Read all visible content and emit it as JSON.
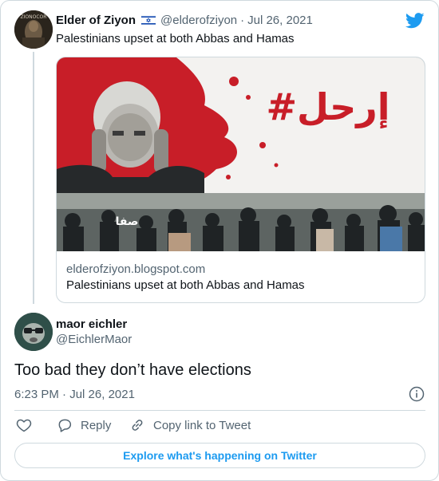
{
  "parent_tweet": {
    "author_name": "Elder of Ziyon",
    "flag_icon": "israel-flag-icon",
    "handle": "@elderofziyon",
    "separator": "·",
    "date": "Jul 26, 2021",
    "text": "Palestinians upset at both Abbas and Hamas",
    "avatar_label": "ZIONOCOR",
    "link_card": {
      "image_text_arabic": "#إرحل",
      "image_logo_text": "صفا",
      "domain": "elderofziyon.blogspot.com",
      "title": "Palestinians upset at both Abbas and Hamas"
    }
  },
  "reply_tweet": {
    "author_name": "maor eichler",
    "handle": "@EichlerMaor",
    "text": "Too bad they don’t have elections",
    "time": "6:23 PM",
    "separator": "·",
    "date": "Jul 26, 2021"
  },
  "actions": {
    "like_icon": "heart-icon",
    "reply_label": "Reply",
    "copy_label": "Copy link to Tweet"
  },
  "footer": {
    "explore_label": "Explore what's happening on Twitter"
  },
  "colors": {
    "accent": "#1d9bf0",
    "muted": "#536471",
    "border": "#cfd9de",
    "banner_red": "#c81e28"
  }
}
